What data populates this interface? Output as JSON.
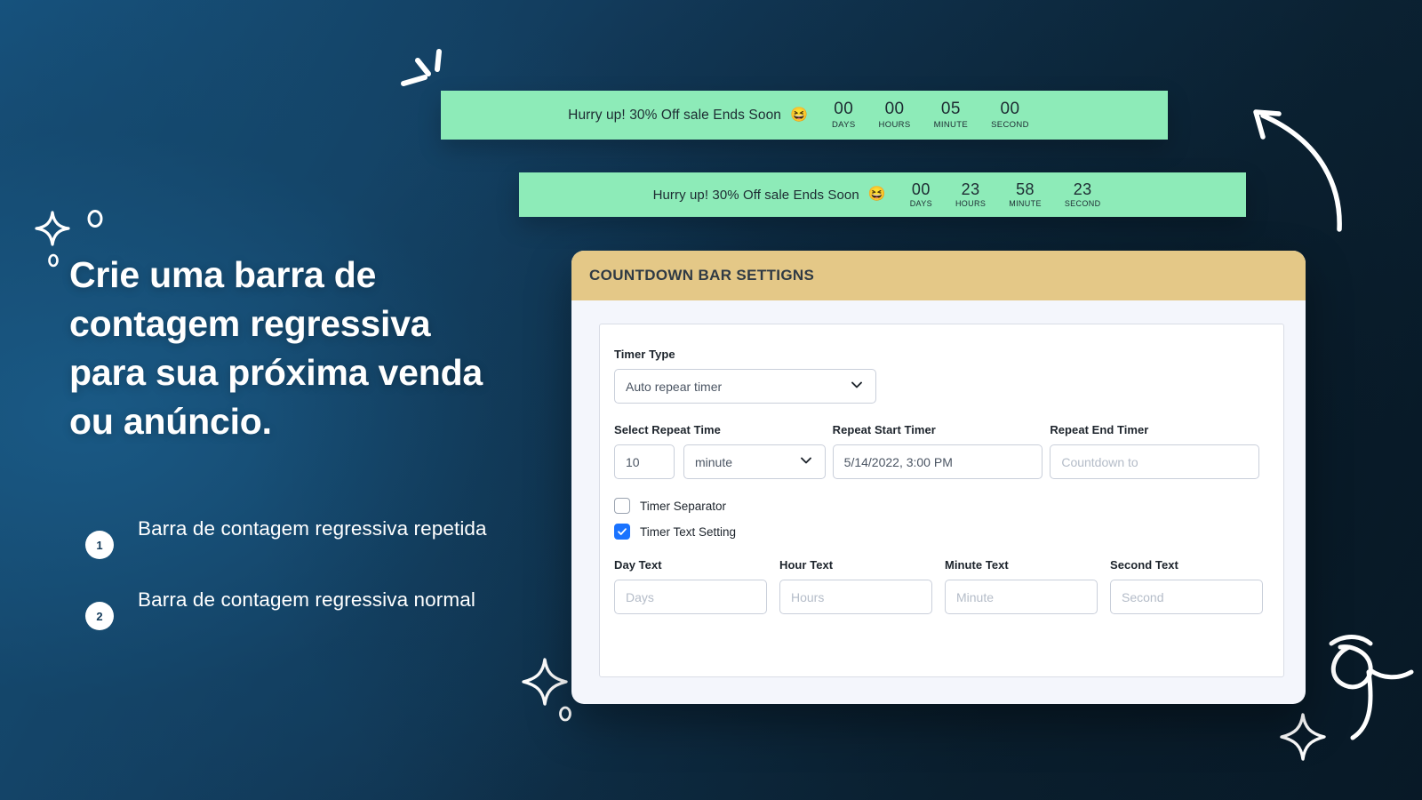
{
  "theme": {
    "bg_dark": "#0d2435",
    "bg_blue": "#175582",
    "bar_green": "#8debb8",
    "header_gold": "#e4c887",
    "checkbox_blue": "#1a73ff",
    "panel_bg": "#f4f6fc"
  },
  "countdown_bars": [
    {
      "message": "Hurry up! 30% Off sale Ends Soon",
      "emoji": "😆",
      "units": [
        {
          "value": "00",
          "label": "DAYS"
        },
        {
          "value": "00",
          "label": "HOURS"
        },
        {
          "value": "05",
          "label": "MINUTE"
        },
        {
          "value": "00",
          "label": "SECOND"
        }
      ]
    },
    {
      "message": "Hurry up! 30% Off sale Ends Soon",
      "emoji": "😆",
      "units": [
        {
          "value": "00",
          "label": "DAYS"
        },
        {
          "value": "23",
          "label": "HOURS"
        },
        {
          "value": "58",
          "label": "MINUTE"
        },
        {
          "value": "23",
          "label": "SECOND"
        }
      ]
    }
  ],
  "promo": {
    "headline": "Crie uma barra de contagem regressiva para sua próxima venda ou anúncio.",
    "features": [
      {
        "number": "1",
        "text": "Barra de contagem regressiva repetida"
      },
      {
        "number": "2",
        "text": "Barra de contagem regressiva normal"
      }
    ]
  },
  "panel": {
    "title": "COUNTDOWN BAR SETTIGNS",
    "timer_type": {
      "label": "Timer Type",
      "value": "Auto repear timer",
      "icon": "chevron-down-icon"
    },
    "select_repeat_time": {
      "label": "Select Repeat Time",
      "quantity": "10",
      "unit": "minute"
    },
    "repeat_start_timer": {
      "label": "Repeat Start Timer",
      "value": "5/14/2022, 3:00 PM"
    },
    "repeat_end_timer": {
      "label": "Repeat End Timer",
      "placeholder": "Countdown to"
    },
    "checkboxes": [
      {
        "label": "Timer Separator",
        "checked": false
      },
      {
        "label": "Timer Text Setting",
        "checked": true
      }
    ],
    "text_fields": [
      {
        "label": "Day Text",
        "placeholder": "Days"
      },
      {
        "label": "Hour Text",
        "placeholder": "Hours"
      },
      {
        "label": "Minute Text",
        "placeholder": "Minute"
      },
      {
        "label": "Second Text",
        "placeholder": "Second"
      }
    ]
  }
}
